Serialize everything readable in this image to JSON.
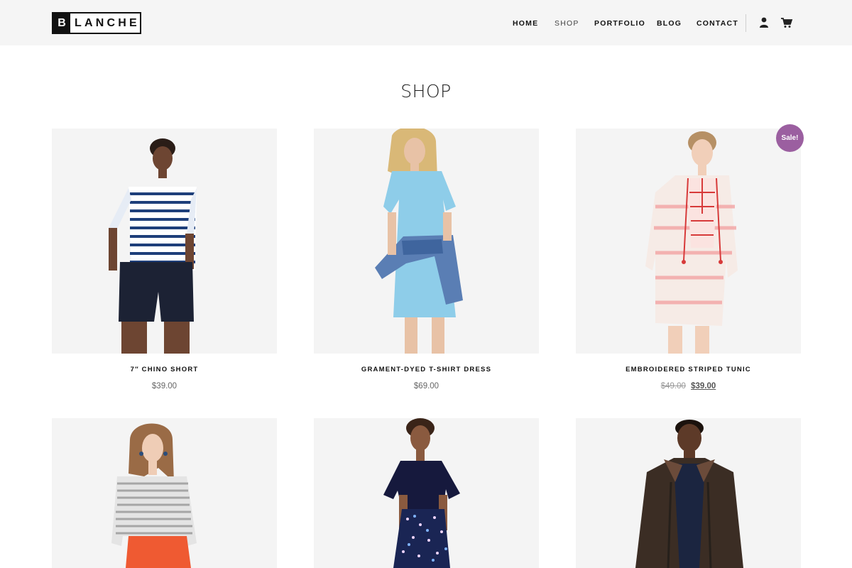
{
  "brand": {
    "logo_initial": "B",
    "logo_rest": "LANCHE"
  },
  "nav": {
    "items": [
      {
        "label": "HOME",
        "active": false
      },
      {
        "label": "SHOP",
        "active": true
      },
      {
        "label": "PORTFOLIO",
        "active": false
      },
      {
        "label": "BLOG",
        "active": false
      },
      {
        "label": "CONTACT",
        "active": false
      }
    ],
    "icons": [
      "user-icon",
      "cart-icon"
    ]
  },
  "page": {
    "title": "SHOP"
  },
  "products": [
    {
      "name": "7″ CHINO SHORT",
      "price": "$39.00",
      "on_sale": false
    },
    {
      "name": "GRAMENT-DYED T-SHIRT DRESS",
      "price": "$69.00",
      "on_sale": false
    },
    {
      "name": "EMBROIDERED STRIPED TUNIC",
      "old_price": "$49.00",
      "price": "$39.00",
      "on_sale": true,
      "badge": "Sale!"
    },
    {
      "name": "",
      "price": "",
      "on_sale": false
    },
    {
      "name": "",
      "price": "",
      "on_sale": false
    },
    {
      "name": "",
      "price": "",
      "on_sale": false
    }
  ],
  "colors": {
    "header_bg": "#f5f5f5",
    "sale_badge": "#9b5fa0",
    "image_bg": "#f4f4f4"
  }
}
